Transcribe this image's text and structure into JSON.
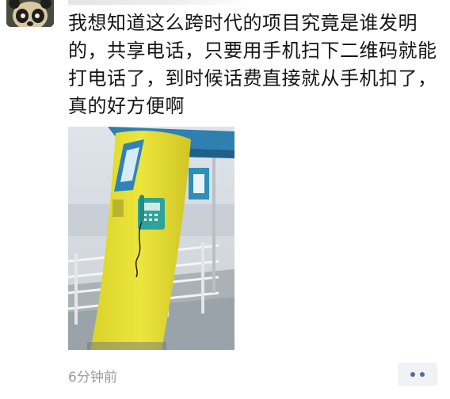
{
  "post": {
    "message": "我想知道这么跨时代的项目究竟是谁发明的，共享电话，只要用手机扫下二维码就能打电话了，到时候话费直接就从手机扣了，真的好方便啊",
    "timestamp": "6分钟前",
    "avatar_icon": "panda-avatar-icon",
    "more_icon": "more-dots-icon",
    "photo_subject": "yellow-payphone-booth"
  },
  "colors": {
    "booth_yellow": "#e8e23a",
    "booth_roof": "#2f7fb0",
    "phone_green": "#2fa39a",
    "timestamp_gray": "#9a9a9a",
    "more_button_bg": "#f1f2f5",
    "more_dots": "#5a6b8c"
  }
}
